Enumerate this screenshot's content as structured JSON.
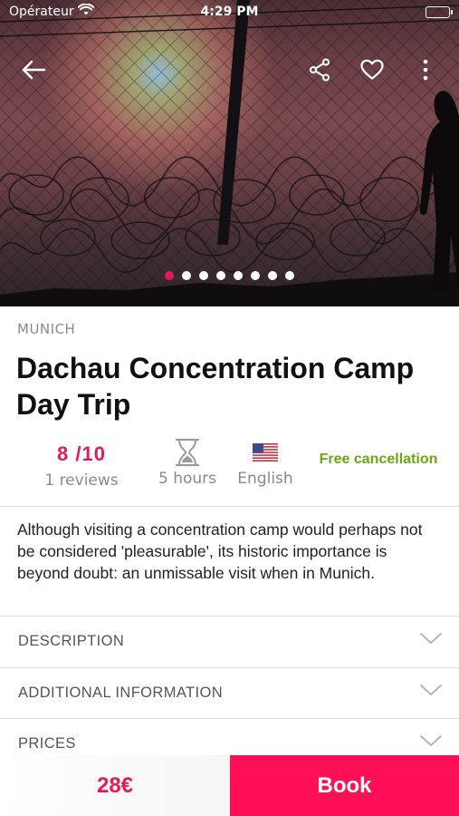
{
  "status_bar": {
    "carrier": "Opérateur",
    "time": "4:29 PM",
    "icons": [
      "wifi-icon",
      "battery-icon"
    ]
  },
  "hero": {
    "image_description_icon": "photo",
    "carousel": {
      "total": 8,
      "active_index": 0
    },
    "actions": [
      "back-arrow-icon",
      "share-icon",
      "heart-icon",
      "more-vertical-icon"
    ]
  },
  "tour": {
    "city": "MUNICH",
    "title": "Dachau Concentration Camp Day Trip",
    "rating": "8 /10",
    "reviews": "1 reviews",
    "duration": "5 hours",
    "language": "English",
    "cancellation": "Free cancellation",
    "summary": "Although visiting a concentration camp would perhaps not be considered 'pleasurable', its historic importance is beyond doubt: an unmissable visit when in Munich."
  },
  "sections": [
    {
      "label": "DESCRIPTION"
    },
    {
      "label": "ADDITIONAL INFORMATION"
    },
    {
      "label": "PRICES"
    }
  ],
  "booking": {
    "price": "28€",
    "button_label": "Book"
  },
  "colors": {
    "accent": "#e6195a",
    "book_button": "#ff0f55",
    "cancellation": "#6aa80f",
    "muted": "#8a8a8a"
  }
}
